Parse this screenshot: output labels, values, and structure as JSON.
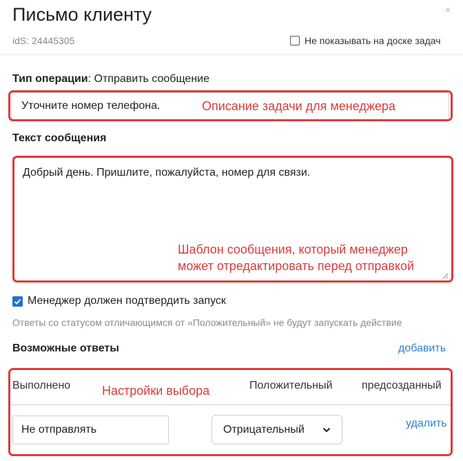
{
  "dialog": {
    "title": "Письмо клиенту",
    "close_glyph": "×",
    "ids_text": "idS: 24445305",
    "hide_from_board_label": "Не показывать на доске задач",
    "hide_from_board_checked": false
  },
  "operation": {
    "label": "Тип операции",
    "separator": ":",
    "value": " Отправить сообщение"
  },
  "task_description": {
    "value": "Уточните номер телефона.",
    "annotation": "Описание задачи для менеджера"
  },
  "message": {
    "label": "Текст сообщения",
    "value": "Добрый день. Пришлите, пожалуйста, номер для связи.",
    "annotation_line1": "Шаблон сообщения, который менеджер",
    "annotation_line2": "может отредактировать перед отправкой"
  },
  "confirm": {
    "label": "Менеджер должен подтвердить запуск",
    "checked": true,
    "hint": "Ответы со статусом отличающимся от «Положительный» не будут запускать действие"
  },
  "answers": {
    "label": "Возможные ответы",
    "add_label": "добавить",
    "annotation": "Настройки выбора",
    "header": {
      "name": "Выполнено",
      "status": "Положительный",
      "type": "предсозданный"
    },
    "row": {
      "name_value": "Не отправлять",
      "status_value": "Отрицательный",
      "delete_label": "удалить"
    }
  },
  "colors": {
    "highlight": "#dc3b3b",
    "link": "#2f7fd8",
    "checkbox": "#1f6fd6"
  }
}
